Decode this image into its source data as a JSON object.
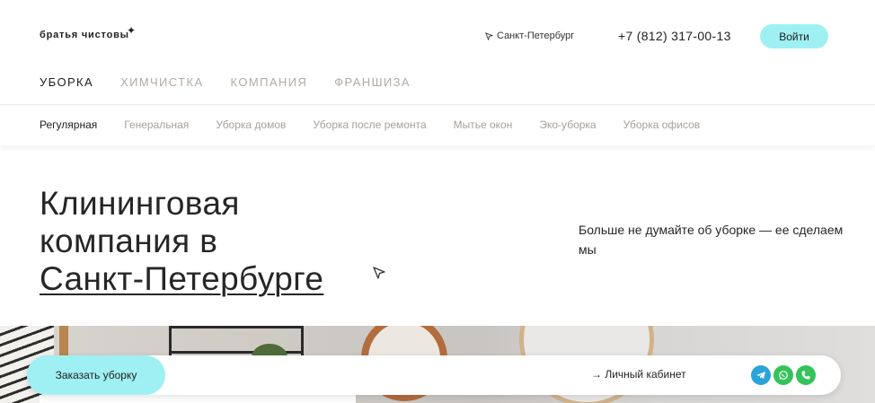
{
  "header": {
    "logo_text": "братья чистовы",
    "city": "Санкт-Петербург",
    "phone": "+7 (812) 317-00-13",
    "login_label": "Войти"
  },
  "main_nav": [
    {
      "label": "УБОРКА",
      "active": true
    },
    {
      "label": "ХИМЧИСТКА",
      "active": false
    },
    {
      "label": "КОМПАНИЯ",
      "active": false
    },
    {
      "label": "ФРАНШИЗА",
      "active": false
    }
  ],
  "sub_nav": [
    {
      "label": "Регулярная",
      "active": true
    },
    {
      "label": "Генеральная",
      "active": false
    },
    {
      "label": "Уборка домов",
      "active": false
    },
    {
      "label": "Уборка после ремонта",
      "active": false
    },
    {
      "label": "Мытье окон",
      "active": false
    },
    {
      "label": "Эко-уборка",
      "active": false
    },
    {
      "label": "Уборка офисов",
      "active": false
    }
  ],
  "hero": {
    "title_line1": "Клининговая",
    "title_line2": "компания в",
    "title_city": "Санкт-Петербурге",
    "subtitle": "Больше не думайте об уборке — ее сделаем мы"
  },
  "bottom_bar": {
    "order_label": "Заказать уборку",
    "cabinet_label": "→ Личный кабинет",
    "messengers": [
      "telegram-icon",
      "whatsapp-icon",
      "phone-icon"
    ]
  },
  "colors": {
    "accent": "#9ff0f2",
    "nav_inactive": "#b3aaa2",
    "text": "#1e1e1e"
  }
}
